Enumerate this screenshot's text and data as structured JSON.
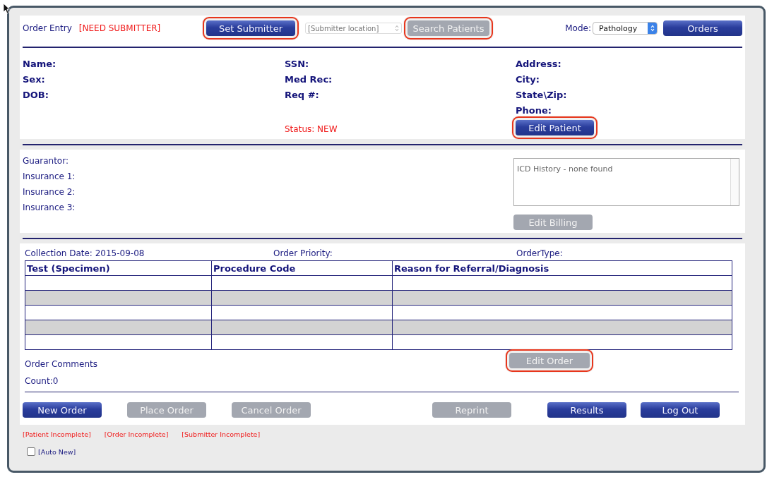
{
  "header": {
    "title": "Order Entry",
    "warning": "[NEED SUBMITTER]",
    "set_submitter": {
      "label": "Set Submitter",
      "disabled": false,
      "highlighted": true
    },
    "location_select": {
      "placeholder": "[Submitter location]"
    },
    "search_patients": {
      "label": "Search Patients",
      "disabled": true,
      "highlighted": true
    },
    "mode": {
      "label": "Mode:",
      "value": "Pathology"
    },
    "orders": {
      "label": "Orders",
      "disabled": false,
      "highlighted": false
    }
  },
  "patient": {
    "columns": [
      [
        "Name:",
        "Sex:",
        "DOB:"
      ],
      [
        "SSN:",
        "Med Rec:",
        "Req #:"
      ],
      [
        "Address:",
        "City:",
        "State\\Zip:",
        "Phone:"
      ]
    ],
    "status": "Status: NEW",
    "edit_patient": {
      "label": "Edit Patient",
      "disabled": false,
      "highlighted": true
    }
  },
  "billing": {
    "labels": [
      "Guarantor:",
      "Insurance 1:",
      "Insurance 2:",
      "Insurance 3:"
    ],
    "icd_history": "ICD History - none found",
    "edit_billing": {
      "label": "Edit Billing",
      "disabled": true,
      "highlighted": false
    }
  },
  "order": {
    "collection_date": "Collection Date: 2015-09-08",
    "priority": "Order Priority:",
    "order_type": "OrderType:",
    "table": {
      "columns": [
        "Test (Specimen)",
        "Procedure Code",
        "Reason for Referral/Diagnosis"
      ],
      "rows": [
        {
          "shaded": false
        },
        {
          "shaded": true
        },
        {
          "shaded": false
        },
        {
          "shaded": true
        },
        {
          "shaded": false
        }
      ]
    },
    "comments": "Order Comments",
    "count": "Count:0",
    "edit_order": {
      "label": "Edit Order",
      "disabled": true,
      "highlighted": true
    }
  },
  "actions": [
    {
      "label": "New Order",
      "disabled": false,
      "highlighted": false
    },
    {
      "label": "Place Order",
      "disabled": true,
      "highlighted": false
    },
    {
      "label": "Cancel Order",
      "disabled": true,
      "highlighted": false
    },
    {
      "label": "Reprint",
      "disabled": true,
      "highlighted": false
    },
    {
      "label": "Results",
      "disabled": false,
      "highlighted": false
    },
    {
      "label": "Log Out",
      "disabled": false,
      "highlighted": false
    }
  ],
  "notes": [
    "[Patient Incomplete]",
    "[Order Incomplete]",
    "[Submitter Incomplete]"
  ],
  "auto_new": {
    "label": "[Auto New]",
    "checked": false
  }
}
